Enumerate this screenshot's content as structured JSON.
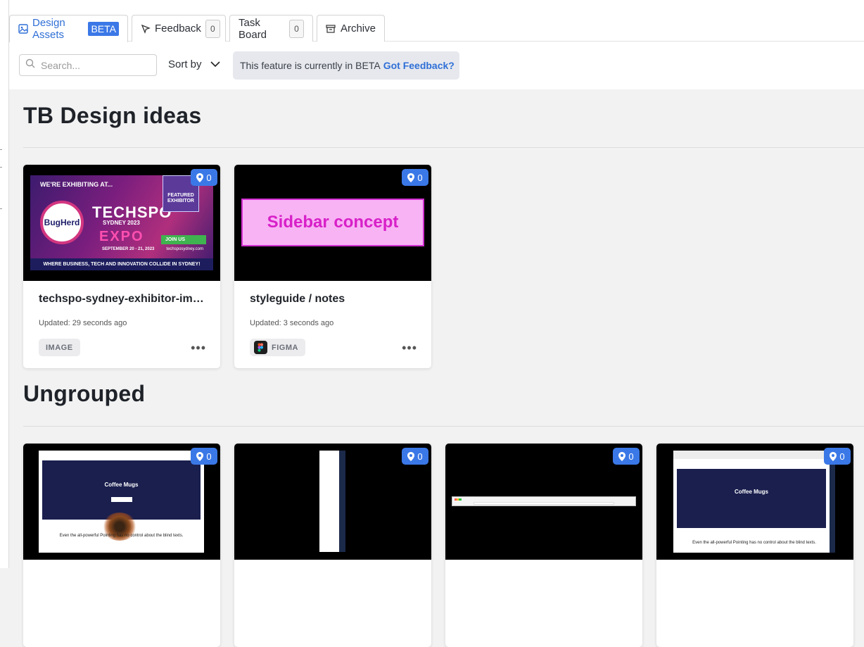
{
  "tabs": [
    {
      "label": "Design Assets",
      "badge": "BETA"
    },
    {
      "label": "Feedback",
      "count": "0"
    },
    {
      "label": "Task Board",
      "count": "0"
    },
    {
      "label": "Archive"
    }
  ],
  "toolbar": {
    "search_placeholder": "Search...",
    "sort_label": "Sort by",
    "beta_note": "This feature is currently in BETA",
    "beta_link": "Got Feedback?"
  },
  "groups": [
    {
      "title": "TB Design ideas",
      "cards": [
        {
          "name": "techspo-sydney-exhibitor-im…",
          "updated": "Updated: 29 seconds ago",
          "type": "IMAGE",
          "pins": "0",
          "banner": {
            "top": "WE'RE EXHIBITING AT...",
            "logo": "BugHerd",
            "techspo": "TECHSPO",
            "sydney": "SYDNEY 2023",
            "expo": "EXPO",
            "dates": "SEPTEMBER 20 - 21, 2023",
            "featured": "FEATURED EXHIBITOR",
            "join": "JOIN US",
            "site": "techsposydney.com",
            "footer": "WHERE BUSINESS, TECH AND INNOVATION COLLIDE IN SYDNEY!"
          }
        },
        {
          "name": "styleguide / notes",
          "updated": "Updated: 3 seconds ago",
          "type": "FIGMA",
          "pins": "0",
          "preview_text": "Sidebar concept"
        }
      ]
    },
    {
      "title": "Ungrouped",
      "cards": [
        {
          "pins": "0",
          "hero_title": "Coffee Mugs",
          "footer_text": "Even the all-powerful Pointing has no control about the blind texts."
        },
        {
          "pins": "0"
        },
        {
          "pins": "0"
        },
        {
          "pins": "0",
          "hero_title": "Coffee Mugs",
          "footer_text": "Even the all-powerful Pointing has no control about the blind texts."
        }
      ]
    }
  ],
  "colors": {
    "accent": "#3b78e7",
    "link": "#2f6fd6",
    "background": "#f2f2f2"
  }
}
